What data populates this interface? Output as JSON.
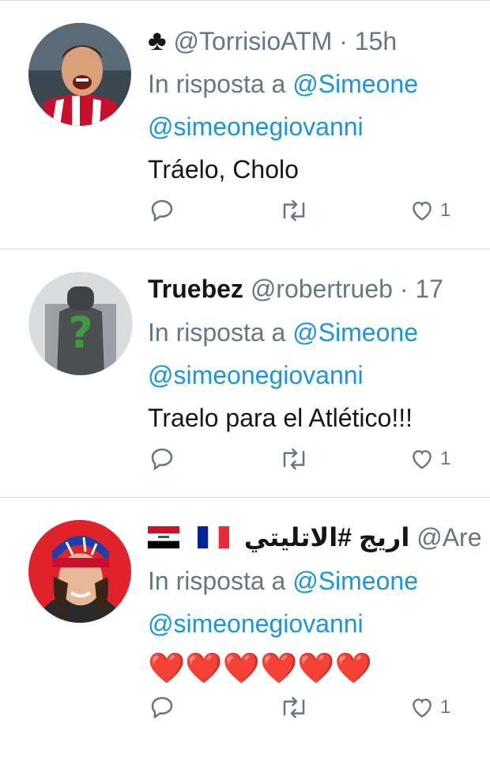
{
  "tweets": [
    {
      "name": "",
      "suit_icon": "club-icon",
      "handle": "@TorrisioATM",
      "dot": "·",
      "time": "15h",
      "reply_prefix": "In risposta a",
      "reply_mention": "@Simeone",
      "mention2": "@simeonegiovanni",
      "text": "Tráelo, Cholo",
      "likes": "1",
      "avatar": "avatar-soccer-player-red-white"
    },
    {
      "name": "Truebez",
      "handle": "@robertrueb",
      "dot": "·",
      "time": "17",
      "reply_prefix": "In risposta a",
      "reply_mention": "@Simeone",
      "mention2": "@simeonegiovanni",
      "text": "Traelo para el Atlético!!!",
      "likes": "1",
      "avatar": "avatar-question-mark-figure"
    },
    {
      "name": "اريج #الاتليتي",
      "flags": [
        "iraq-flag-icon",
        "france-flag-icon"
      ],
      "handle": "@Are",
      "reply_prefix": "In risposta a",
      "reply_mention": "@Simeone",
      "mention2": "@simeonegiovanni",
      "text": "❤️❤️❤️❤️❤️❤️",
      "likes": "1",
      "avatar": "avatar-woman-with-hat"
    }
  ],
  "colors": {
    "link": "#1b95e0",
    "secondary": "#657786",
    "divider": "#d9dde1"
  }
}
